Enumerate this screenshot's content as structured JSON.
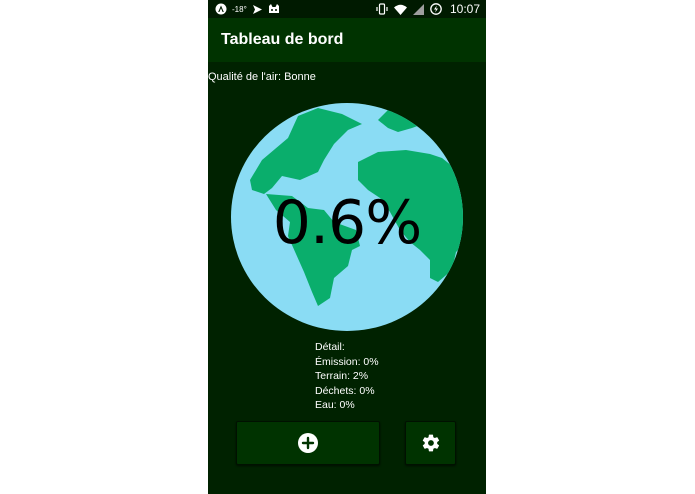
{
  "status_bar": {
    "temperature": "-18°",
    "time": "10:07",
    "icons": [
      "app-a-icon",
      "temperature-icon",
      "send-icon",
      "cat-icon",
      "vibrate-icon",
      "wifi-icon",
      "signal-icon",
      "battery-charging-icon"
    ]
  },
  "app_bar": {
    "title": "Tableau de bord"
  },
  "air_quality": {
    "label": "Qualité de l'air: Bonne"
  },
  "globe": {
    "percent": "0.6%",
    "colors": {
      "ocean": "#8adcf4",
      "land": "#0aae6c",
      "background": "#002200"
    }
  },
  "details": {
    "heading": "Détail:",
    "emission": "Émission: 0%",
    "terrain": "Terrain: 2%",
    "dechets": "Déchets: 0%",
    "eau": "Eau: 0%"
  },
  "buttons": {
    "add_icon": "plus-circle-icon",
    "settings_icon": "gear-icon"
  }
}
